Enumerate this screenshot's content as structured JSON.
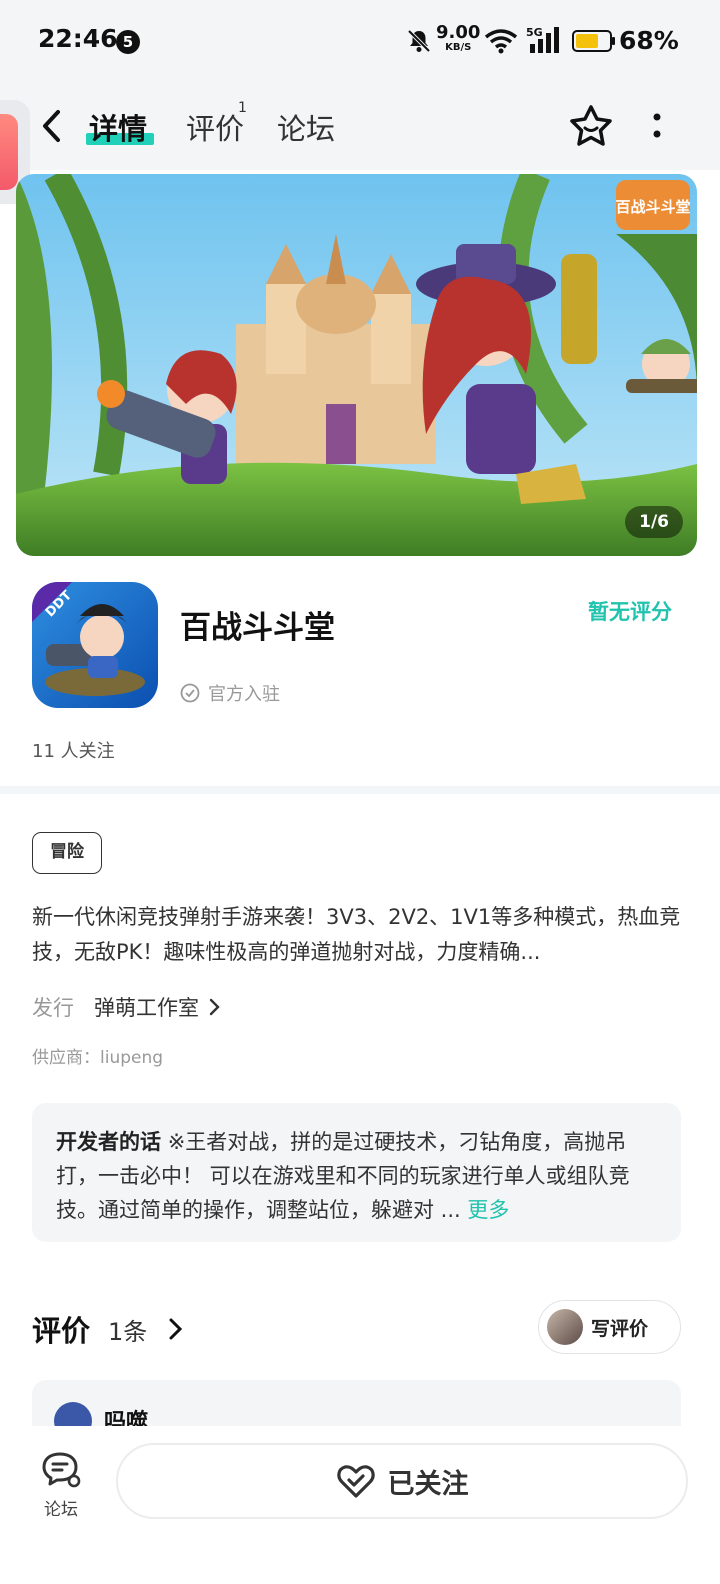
{
  "status_bar": {
    "time": "22:46",
    "notification_count": "5",
    "net_speed": "9.00",
    "net_unit": "KB/S",
    "signal_label": "5G",
    "battery": "68%",
    "battery_level": 0.68
  },
  "header": {
    "tabs": [
      {
        "label": "详情",
        "active": true
      },
      {
        "label": "评价",
        "badge": "1"
      },
      {
        "label": "论坛"
      }
    ],
    "icons": [
      "back-arrow-icon",
      "star-icon",
      "more-vertical-icon"
    ]
  },
  "banner": {
    "pager": "1/6",
    "logo_text": "百战斗斗堂"
  },
  "game": {
    "icon_text": "DDT",
    "name": "百战斗斗堂",
    "rating": "暂无评分",
    "official": "官方入驻",
    "followers": "11 人关注"
  },
  "tag": "冒险",
  "description": "新一代休闲竞技弹射手游来袭！3V3、2V2、1V1等多种模式，热血竞技，无敌PK！趣味性极高的弹道抛射对战，力度精确...",
  "publisher": {
    "label": "发行",
    "value": "弹萌工作室"
  },
  "supplier": "供应商：liupeng",
  "developer_note": {
    "title": "开发者的话",
    "text": "※王者对战，拼的是过硬技术，刁钻角度，高抛吊打，一击必中！ 可以在游戏里和不同的玩家进行单人或组队竞技。通过简单的操作，调整站位，躲避对 ...",
    "more": "更多"
  },
  "reviews": {
    "title": "评价",
    "count": "1条",
    "write": "写评价",
    "first_user": "吗噬"
  },
  "bottom": {
    "forum": "论坛",
    "follow": "已关注"
  },
  "colors": {
    "accent": "#20c3ad",
    "tab_underline": "#21d0b8",
    "battery": "#f4c20d"
  }
}
